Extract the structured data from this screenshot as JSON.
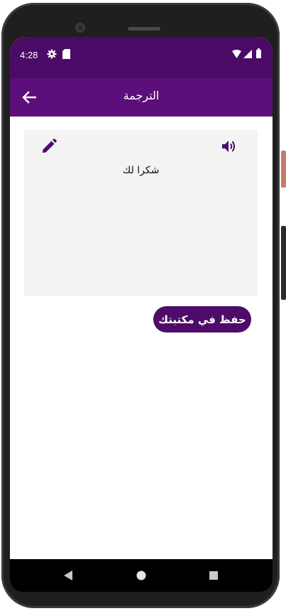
{
  "status_bar": {
    "time": "4:28",
    "icons": [
      "gear-icon",
      "sd-card-icon",
      "wifi-icon",
      "signal-icon",
      "battery-icon"
    ]
  },
  "app_bar": {
    "title": "الترجمة",
    "back_icon": "arrow-left-icon"
  },
  "card": {
    "text": "شكرا لك",
    "edit_icon": "pencil-icon",
    "speaker_icon": "speaker-icon"
  },
  "actions": {
    "save_label": "حفظ في مكتبتك"
  },
  "nav_bar": {
    "icons": [
      "back-triangle-icon",
      "home-circle-icon",
      "recents-square-icon"
    ]
  },
  "colors": {
    "status_bar": "#4b0a66",
    "app_bar": "#5c0f7a",
    "accent": "#4e0b69",
    "card_background": "#f3f3f3"
  }
}
